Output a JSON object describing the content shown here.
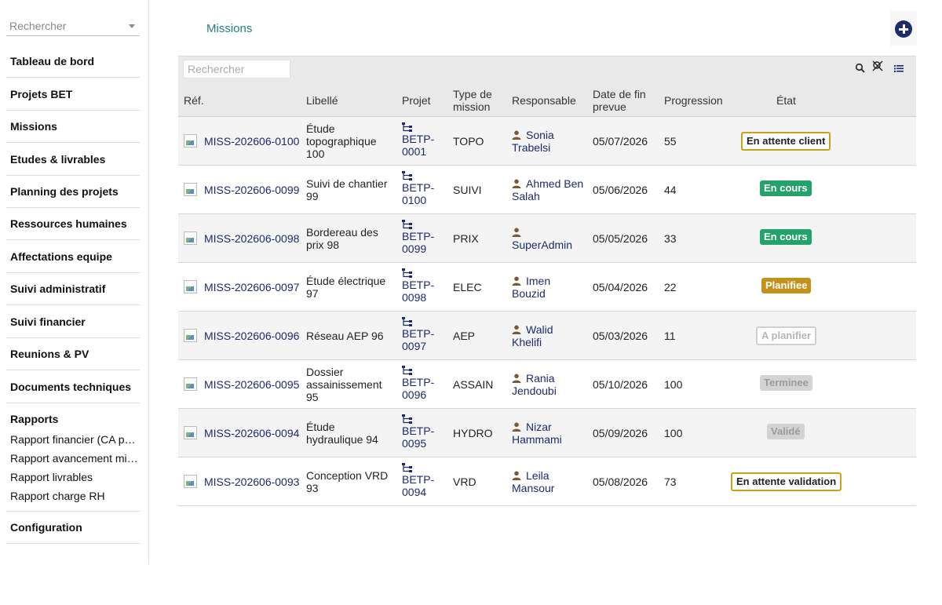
{
  "sidebar": {
    "search_placeholder": "Rechercher",
    "items": [
      {
        "label": "Tableau de bord"
      },
      {
        "label": "Projets BET"
      },
      {
        "label": "Missions"
      },
      {
        "label": "Etudes & livrables"
      },
      {
        "label": "Planning des projets"
      },
      {
        "label": "Ressources humaines"
      },
      {
        "label": "Affectations equipe"
      },
      {
        "label": "Suivi administratif"
      },
      {
        "label": "Suivi financier"
      },
      {
        "label": "Reunions & PV"
      },
      {
        "label": "Documents techniques"
      }
    ],
    "rapports": {
      "label": "Rapports",
      "subitems": [
        {
          "label": "Rapport financier (CA par projet)"
        },
        {
          "label": "Rapport avancement missions"
        },
        {
          "label": "Rapport livrables"
        },
        {
          "label": "Rapport charge RH"
        }
      ]
    },
    "configuration": {
      "label": "Configuration"
    }
  },
  "header": {
    "title": "Missions",
    "add_icon": "plus-circle-icon"
  },
  "table": {
    "search_placeholder": "Rechercher",
    "tools": [
      "search-icon",
      "clear-filter-icon",
      "list-view-icon"
    ],
    "columns": {
      "ref": "Réf.",
      "libelle": "Libellé",
      "projet": "Projet",
      "type_l1": "Type de",
      "type_l2": "mission",
      "responsable": "Responsable",
      "date_l1": "Date de fin",
      "date_l2": "prevue",
      "progression": "Progression",
      "etat": "État"
    },
    "rows": [
      {
        "ref": "MISS-202606-0100",
        "libelle": [
          "Étude",
          "topographique",
          "100"
        ],
        "projet": [
          "BETP-",
          "0001"
        ],
        "type": "TOPO",
        "responsable": [
          "Sonia",
          "Trabelsi"
        ],
        "date": "05/07/2026",
        "progression": "55",
        "etat": "En attente client",
        "etat_style": "outline"
      },
      {
        "ref": "MISS-202606-0099",
        "libelle": [
          "Suivi de chantier",
          "99"
        ],
        "projet": [
          "BETP-",
          "0100"
        ],
        "type": "SUIVI",
        "responsable": [
          "Ahmed Ben",
          "Salah"
        ],
        "date": "05/06/2026",
        "progression": "44",
        "etat": "En cours",
        "etat_style": "green"
      },
      {
        "ref": "MISS-202606-0098",
        "libelle": [
          "Bordereau des",
          "prix 98"
        ],
        "projet": [
          "BETP-",
          "0099"
        ],
        "type": "PRIX",
        "responsable": [
          "",
          "SuperAdmin"
        ],
        "date": "05/05/2026",
        "progression": "33",
        "etat": "En cours",
        "etat_style": "green"
      },
      {
        "ref": "MISS-202606-0097",
        "libelle": [
          "Étude électrique",
          "97"
        ],
        "projet": [
          "BETP-",
          "0098"
        ],
        "type": "ELEC",
        "responsable": [
          "Imen",
          "Bouzid"
        ],
        "date": "05/04/2026",
        "progression": "22",
        "etat": "Planifiee",
        "etat_style": "amber"
      },
      {
        "ref": "MISS-202606-0096",
        "libelle": [
          "Réseau AEP 96"
        ],
        "projet": [
          "BETP-",
          "0097"
        ],
        "type": "AEP",
        "responsable": [
          "Walid",
          "Khelifi"
        ],
        "date": "05/03/2026",
        "progression": "11",
        "etat": "A planifier",
        "etat_style": "ghost"
      },
      {
        "ref": "MISS-202606-0095",
        "libelle": [
          "Dossier",
          "assainissement",
          "95"
        ],
        "projet": [
          "BETP-",
          "0096"
        ],
        "type": "ASSAIN",
        "responsable": [
          "Rania",
          "Jendoubi"
        ],
        "date": "05/10/2026",
        "progression": "100",
        "etat": "Terminee",
        "etat_style": "grey"
      },
      {
        "ref": "MISS-202606-0094",
        "libelle": [
          "Étude",
          "hydraulique 94"
        ],
        "projet": [
          "BETP-",
          "0095"
        ],
        "type": "HYDRO",
        "responsable": [
          "Nizar",
          "Hammami"
        ],
        "date": "05/09/2026",
        "progression": "100",
        "etat": "Validé",
        "etat_style": "grey"
      },
      {
        "ref": "MISS-202606-0093",
        "libelle": [
          "Conception VRD",
          "93"
        ],
        "projet": [
          "BETP-",
          "0094"
        ],
        "type": "VRD",
        "responsable": [
          "Leila",
          "Mansour"
        ],
        "date": "05/08/2026",
        "progression": "73",
        "etat": "En attente validation",
        "etat_style": "outline"
      }
    ]
  },
  "colors": {
    "title": "#1f7e86",
    "link": "#1b2a6e",
    "green": "#23a26a",
    "amber": "#c4921b",
    "user_icon": "#7a5a35"
  }
}
